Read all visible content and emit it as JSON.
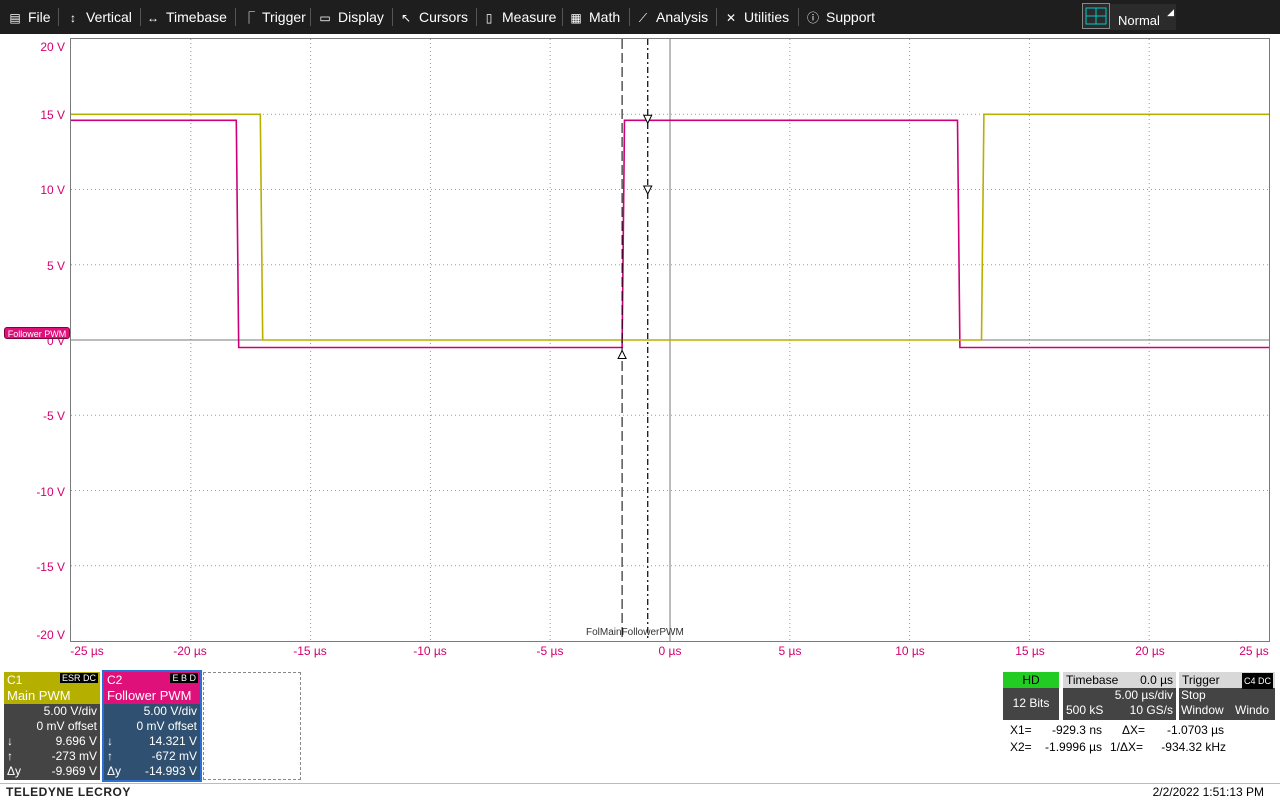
{
  "menu": {
    "items": [
      {
        "label": "File",
        "icon": "file-icon"
      },
      {
        "label": "Vertical",
        "icon": "vertical-icon"
      },
      {
        "label": "Timebase",
        "icon": "timebase-icon"
      },
      {
        "label": "Trigger",
        "icon": "trigger-icon"
      },
      {
        "label": "Display",
        "icon": "display-icon"
      },
      {
        "label": "Cursors",
        "icon": "cursors-icon"
      },
      {
        "label": "Measure",
        "icon": "measure-icon"
      },
      {
        "label": "Math",
        "icon": "math-icon"
      },
      {
        "label": "Analysis",
        "icon": "analysis-icon"
      },
      {
        "label": "Utilities",
        "icon": "utilities-icon"
      },
      {
        "label": "Support",
        "icon": "support-icon"
      }
    ],
    "acquisition_mode": "Normal"
  },
  "grid": {
    "y_labels": [
      "20 V",
      "15 V",
      "10 V",
      "5 V",
      "0 V",
      "-5 V",
      "-10 V",
      "-15 V",
      "-20 V"
    ],
    "x_labels": [
      "-25 µs",
      "-20 µs",
      "-15 µs",
      "-10 µs",
      "-5 µs",
      "0 µs",
      "5 µs",
      "10 µs",
      "15 µs",
      "20 µs",
      "25 µs"
    ],
    "trace_marker": "Follower PWM",
    "trace_label_overlap": "FolMainFollowerPWM",
    "colors": {
      "c1": "#b8b000",
      "c2": "#cc0077",
      "axis": "#d4006e"
    }
  },
  "waveform_data": {
    "x_unit": "µs",
    "y_unit": "V",
    "xlim": [
      -25,
      25
    ],
    "ylim": [
      -20,
      20
    ],
    "series": [
      {
        "name": "Main PWM",
        "x": [
          -25,
          -17.1,
          -17.0,
          13.0,
          13.1,
          25
        ],
        "y": [
          15.0,
          15.0,
          0,
          0,
          15.0,
          15.0
        ]
      },
      {
        "name": "Follower PWM",
        "x": [
          -25,
          -18.1,
          -18.0,
          -2.0,
          -1.9,
          12.0,
          12.1,
          25
        ],
        "y": [
          14.6,
          14.6,
          -0.5,
          -0.5,
          14.6,
          14.6,
          -0.5,
          -0.5
        ]
      }
    ],
    "cursors": {
      "x1_us": -0.9293,
      "x2_us": -1.9996
    }
  },
  "channels": [
    {
      "id": "C1",
      "name": "Main PWM",
      "badges": "ESR DC",
      "vdiv": "5.00 V/div",
      "offset": "0 mV offset",
      "down": "9.696 V",
      "up": "-273 mV",
      "dy": "-9.969 V",
      "color": "#b5b000"
    },
    {
      "id": "C2",
      "name": "Follower PWM",
      "badges": "E B D",
      "vdiv": "5.00 V/div",
      "offset": "0 mV offset",
      "down": "14.321 V",
      "up": "-672 mV",
      "dy": "-14.993 V",
      "color": "#e0107a"
    }
  ],
  "row_labels": {
    "down": "↓",
    "up": "↑",
    "dy": "Δy"
  },
  "acquisition": {
    "hd": "HD",
    "bits": "12 Bits",
    "timebase_label": "Timebase",
    "timebase_delay": "0.0 µs",
    "timebase_div": "5.00 µs/div",
    "samples": "500 kS",
    "rate": "10 GS/s",
    "trigger_label": "Trigger",
    "trigger_badges": "C4 DC",
    "trigger_mode": "Stop",
    "trigger_type": "Window",
    "trigger_type2": "Windo"
  },
  "cursor_readout": {
    "x1_label": "X1=",
    "x1": "-929.3 ns",
    "dx_label": "ΔX=",
    "dx": "-1.0703 µs",
    "x2_label": "X2=",
    "x2": "-1.9996 µs",
    "inv_dx_label": "1/ΔX=",
    "inv_dx": "-934.32 kHz"
  },
  "footer": {
    "brand": "TELEDYNE LECROY",
    "datetime": "2/2/2022 1:51:13 PM"
  }
}
